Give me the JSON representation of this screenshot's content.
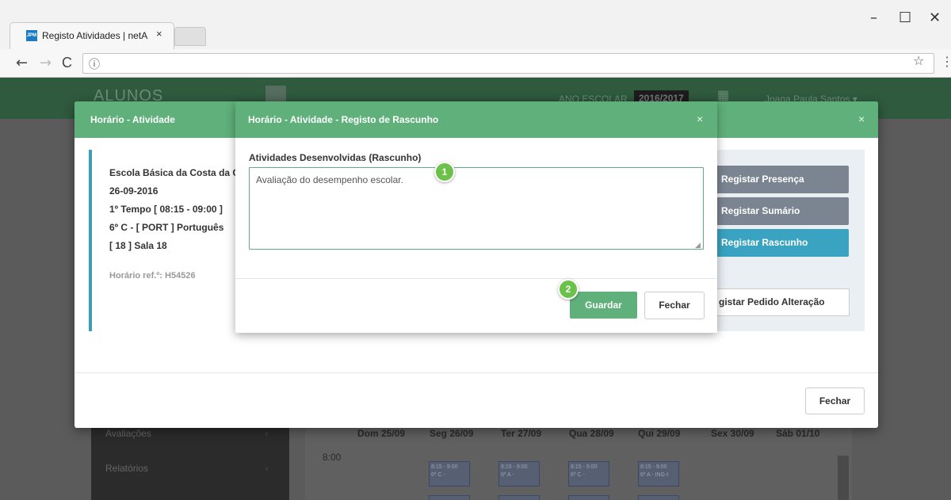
{
  "browser": {
    "tab_title": "Registo Atividades | netA",
    "tab_close": "×",
    "favicon_text": "JPM",
    "window_controls": [
      "–",
      "☐",
      "✕"
    ],
    "nav": {
      "back": "←",
      "forward": "→",
      "reload": "C"
    },
    "address_info_icon": "ⓘ",
    "star": "☆",
    "menu": "⋮"
  },
  "app": {
    "brand": "ALUNOS",
    "year_label": "ANO ESCOLAR",
    "year_value": "2016/2017",
    "user": "Joana Paula Santos ▾",
    "sidebar_items": [
      "Avaliações",
      "Relatórios"
    ],
    "calendar": {
      "days": [
        "Dom 25/09",
        "Seg 26/09",
        "Ter 27/09",
        "Qua 28/09",
        "Qui 29/09",
        "Sex 30/09",
        "Sáb 01/10"
      ],
      "time": "8:00",
      "slots": [
        {
          "time": "8:15 - 9:00",
          "label": "6º C -"
        },
        {
          "time": "8:15 - 9:00",
          "label": "6º A -"
        },
        {
          "time": "8:15 - 9:00",
          "label": "6º C -"
        },
        {
          "time": "8:15 - 9:00",
          "label": "6º A - ING-I"
        }
      ]
    }
  },
  "outer_modal": {
    "title": "Horário - Atividade",
    "close": "×",
    "info": {
      "school": "Escola Básica da Costa da C",
      "date": "26-09-2016",
      "time": "1º Tempo [ 08:15 - 09:00 ]",
      "class": "6º C - [ PORT ] Português",
      "room": "[ 18 ] Sala 18",
      "ref": "Horário ref.º: H54526"
    },
    "actions": {
      "presenca": "Registar Presença",
      "sumario": "Registar Sumário",
      "rascunho": "Registar Rascunho",
      "pedido": "gistar Pedido Alteração"
    },
    "colors": {
      "presenca": "#7a8591",
      "sumario": "#7a8591",
      "rascunho": "#3aa3c1"
    },
    "close_button": "Fechar"
  },
  "inner_modal": {
    "title": "Horário - Atividade - Registo de Rascunho",
    "close": "×",
    "field_label": "Atividades Desenvolvidas (Rascunho)",
    "field_value": "Avaliação do desempenho escolar.",
    "save_button": "Guardar",
    "close_button": "Fechar"
  },
  "badges": {
    "step1": "1",
    "step2": "2"
  }
}
